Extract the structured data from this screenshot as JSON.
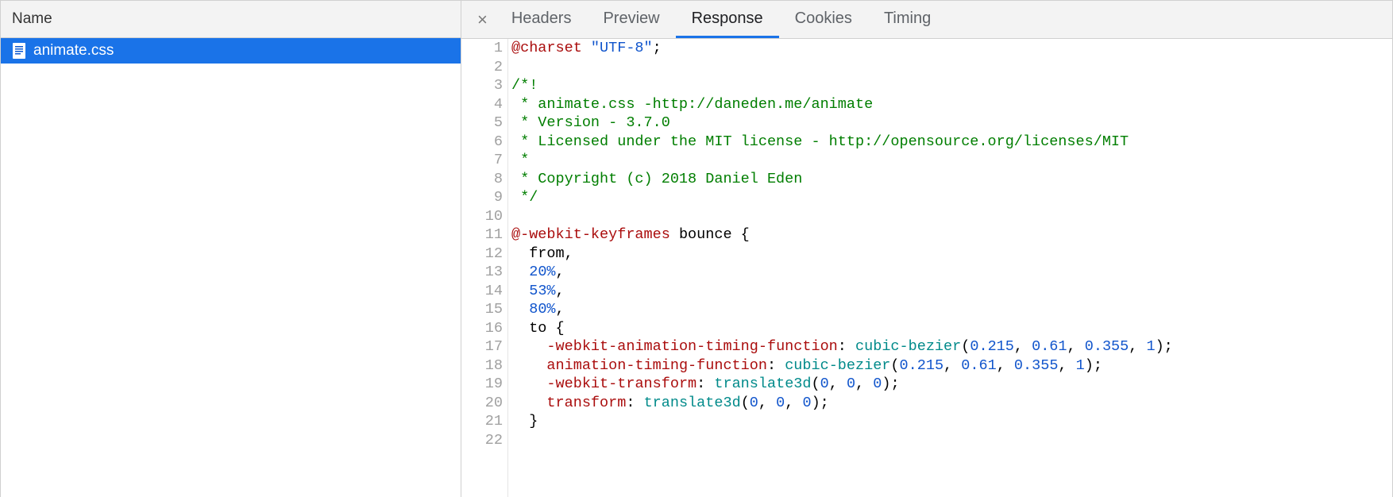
{
  "left": {
    "header": "Name",
    "files": [
      {
        "name": "animate.css"
      }
    ]
  },
  "tabs": {
    "close": "×",
    "items": [
      {
        "label": "Headers",
        "active": false
      },
      {
        "label": "Preview",
        "active": false
      },
      {
        "label": "Response",
        "active": true
      },
      {
        "label": "Cookies",
        "active": false
      },
      {
        "label": "Timing",
        "active": false
      }
    ]
  },
  "code": {
    "lines": [
      {
        "n": 1,
        "tokens": [
          {
            "t": "@charset ",
            "c": "tok-at"
          },
          {
            "t": "\"UTF-8\"",
            "c": "tok-string"
          },
          {
            "t": ";",
            "c": ""
          }
        ]
      },
      {
        "n": 2,
        "tokens": [
          {
            "t": "",
            "c": ""
          }
        ]
      },
      {
        "n": 3,
        "tokens": [
          {
            "t": "/*!",
            "c": "tok-comment"
          }
        ]
      },
      {
        "n": 4,
        "tokens": [
          {
            "t": " * animate.css -http://daneden.me/animate",
            "c": "tok-comment"
          }
        ]
      },
      {
        "n": 5,
        "tokens": [
          {
            "t": " * Version - 3.7.0",
            "c": "tok-comment"
          }
        ]
      },
      {
        "n": 6,
        "tokens": [
          {
            "t": " * Licensed under the MIT license - http://opensource.org/licenses/MIT",
            "c": "tok-comment"
          }
        ]
      },
      {
        "n": 7,
        "tokens": [
          {
            "t": " *",
            "c": "tok-comment"
          }
        ]
      },
      {
        "n": 8,
        "tokens": [
          {
            "t": " * Copyright (c) 2018 Daniel Eden",
            "c": "tok-comment"
          }
        ]
      },
      {
        "n": 9,
        "tokens": [
          {
            "t": " */",
            "c": "tok-comment"
          }
        ]
      },
      {
        "n": 10,
        "tokens": [
          {
            "t": "",
            "c": ""
          }
        ]
      },
      {
        "n": 11,
        "tokens": [
          {
            "t": "@-webkit-keyframes",
            "c": "tok-at"
          },
          {
            "t": " bounce {",
            "c": ""
          }
        ]
      },
      {
        "n": 12,
        "tokens": [
          {
            "t": "  from,",
            "c": ""
          }
        ]
      },
      {
        "n": 13,
        "tokens": [
          {
            "t": "  ",
            "c": ""
          },
          {
            "t": "20%",
            "c": "tok-num"
          },
          {
            "t": ",",
            "c": ""
          }
        ]
      },
      {
        "n": 14,
        "tokens": [
          {
            "t": "  ",
            "c": ""
          },
          {
            "t": "53%",
            "c": "tok-num"
          },
          {
            "t": ",",
            "c": ""
          }
        ]
      },
      {
        "n": 15,
        "tokens": [
          {
            "t": "  ",
            "c": ""
          },
          {
            "t": "80%",
            "c": "tok-num"
          },
          {
            "t": ",",
            "c": ""
          }
        ]
      },
      {
        "n": 16,
        "tokens": [
          {
            "t": "  to {",
            "c": ""
          }
        ]
      },
      {
        "n": 17,
        "tokens": [
          {
            "t": "    ",
            "c": ""
          },
          {
            "t": "-webkit-animation-timing-function",
            "c": "tok-prop"
          },
          {
            "t": ": ",
            "c": ""
          },
          {
            "t": "cubic-bezier",
            "c": "tok-func"
          },
          {
            "t": "(",
            "c": ""
          },
          {
            "t": "0.215",
            "c": "tok-num"
          },
          {
            "t": ", ",
            "c": ""
          },
          {
            "t": "0.61",
            "c": "tok-num"
          },
          {
            "t": ", ",
            "c": ""
          },
          {
            "t": "0.355",
            "c": "tok-num"
          },
          {
            "t": ", ",
            "c": ""
          },
          {
            "t": "1",
            "c": "tok-num"
          },
          {
            "t": ");",
            "c": ""
          }
        ]
      },
      {
        "n": 18,
        "tokens": [
          {
            "t": "    ",
            "c": ""
          },
          {
            "t": "animation-timing-function",
            "c": "tok-prop"
          },
          {
            "t": ": ",
            "c": ""
          },
          {
            "t": "cubic-bezier",
            "c": "tok-func"
          },
          {
            "t": "(",
            "c": ""
          },
          {
            "t": "0.215",
            "c": "tok-num"
          },
          {
            "t": ", ",
            "c": ""
          },
          {
            "t": "0.61",
            "c": "tok-num"
          },
          {
            "t": ", ",
            "c": ""
          },
          {
            "t": "0.355",
            "c": "tok-num"
          },
          {
            "t": ", ",
            "c": ""
          },
          {
            "t": "1",
            "c": "tok-num"
          },
          {
            "t": ");",
            "c": ""
          }
        ]
      },
      {
        "n": 19,
        "tokens": [
          {
            "t": "    ",
            "c": ""
          },
          {
            "t": "-webkit-transform",
            "c": "tok-prop"
          },
          {
            "t": ": ",
            "c": ""
          },
          {
            "t": "translate3d",
            "c": "tok-func"
          },
          {
            "t": "(",
            "c": ""
          },
          {
            "t": "0",
            "c": "tok-num"
          },
          {
            "t": ", ",
            "c": ""
          },
          {
            "t": "0",
            "c": "tok-num"
          },
          {
            "t": ", ",
            "c": ""
          },
          {
            "t": "0",
            "c": "tok-num"
          },
          {
            "t": ");",
            "c": ""
          }
        ]
      },
      {
        "n": 20,
        "tokens": [
          {
            "t": "    ",
            "c": ""
          },
          {
            "t": "transform",
            "c": "tok-prop"
          },
          {
            "t": ": ",
            "c": ""
          },
          {
            "t": "translate3d",
            "c": "tok-func"
          },
          {
            "t": "(",
            "c": ""
          },
          {
            "t": "0",
            "c": "tok-num"
          },
          {
            "t": ", ",
            "c": ""
          },
          {
            "t": "0",
            "c": "tok-num"
          },
          {
            "t": ", ",
            "c": ""
          },
          {
            "t": "0",
            "c": "tok-num"
          },
          {
            "t": ");",
            "c": ""
          }
        ]
      },
      {
        "n": 21,
        "tokens": [
          {
            "t": "  }",
            "c": ""
          }
        ]
      },
      {
        "n": 22,
        "tokens": [
          {
            "t": "",
            "c": ""
          }
        ]
      }
    ]
  }
}
